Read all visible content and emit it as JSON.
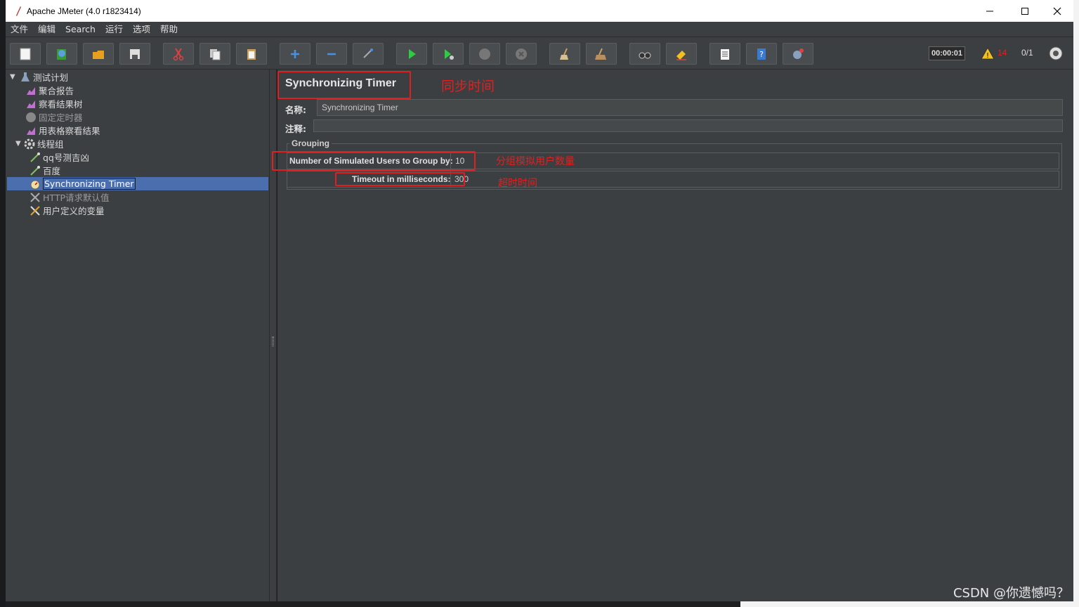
{
  "window": {
    "title": "Apache JMeter (4.0 r1823414)"
  },
  "menubar": {
    "items": [
      "文件",
      "编辑",
      "Search",
      "运行",
      "选项",
      "帮助"
    ]
  },
  "toolbar": {
    "timer": "00:00:01",
    "warning_count": "14",
    "thread_count": "0/1"
  },
  "tree": {
    "root": "测试计划",
    "items": [
      {
        "label": "聚合报告",
        "icon": "graph-icon"
      },
      {
        "label": "察看结果树",
        "icon": "graph-icon"
      },
      {
        "label": "固定定时器",
        "icon": "timer-disabled-icon"
      },
      {
        "label": "用表格察看结果",
        "icon": "graph-icon"
      },
      {
        "label": "线程组",
        "icon": "gear-icon"
      },
      {
        "label": "qq号测吉凶",
        "icon": "pipette-icon"
      },
      {
        "label": "百度",
        "icon": "pipette-icon"
      },
      {
        "label": "Synchronizing Timer",
        "icon": "stopwatch-icon"
      },
      {
        "label": "HTTP请求默认值",
        "icon": "tools-icon"
      },
      {
        "label": "用户定义的变量",
        "icon": "tools-icon"
      }
    ]
  },
  "panel": {
    "title": "Synchronizing Timer",
    "name_label": "名称:",
    "name_value": "Synchronizing Timer",
    "comment_label": "注释:",
    "group_title": "Grouping",
    "users_label": "Number of Simulated Users to Group by:",
    "users_value": "10",
    "timeout_label": "Timeout in milliseconds:",
    "timeout_value": "300"
  },
  "annotations": {
    "title_note": "同步时间",
    "users_note": "分组模拟用户数量",
    "timeout_note": "超时时间"
  },
  "watermark": "CSDN @你遗憾吗？",
  "colors": {
    "panel_bg": "#3c3f41",
    "selection": "#4b6eaf",
    "annotation_red": "#e02020"
  }
}
